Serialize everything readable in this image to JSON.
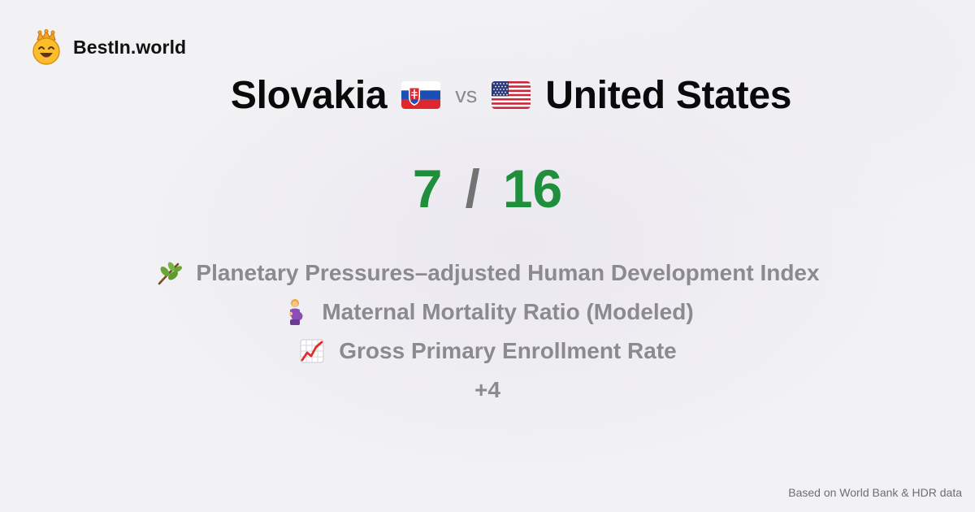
{
  "brand": {
    "name": "BestIn.world",
    "logo_icon": "crowned-smiley-icon"
  },
  "comparison": {
    "country_a": {
      "name": "Slovakia",
      "flag_icon": "slovakia-flag-icon"
    },
    "vs_label": "vs",
    "country_b": {
      "name": "United States",
      "flag_icon": "united-states-flag-icon"
    }
  },
  "score": {
    "a": "7",
    "separator": "/",
    "b": "16",
    "color": "#1f8f3d"
  },
  "metrics": [
    {
      "icon": "herb-icon",
      "label": "Planetary Pressures–adjusted Human Development Index"
    },
    {
      "icon": "pregnant-woman-icon",
      "label": "Maternal Mortality Ratio (Modeled)"
    },
    {
      "icon": "chart-increasing-icon",
      "label": "Gross Primary Enrollment Rate"
    }
  ],
  "more_label": "+4",
  "footer": {
    "source": "Based on World Bank & HDR data"
  }
}
